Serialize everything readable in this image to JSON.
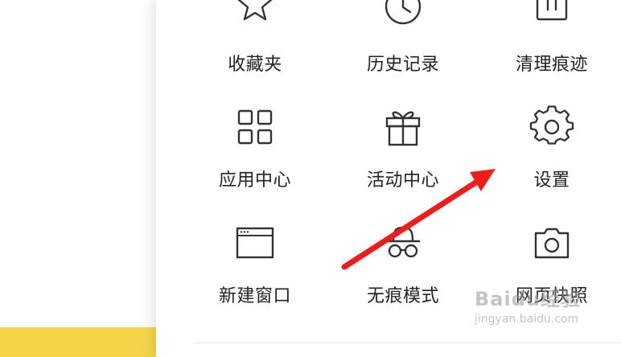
{
  "menu": {
    "items": [
      {
        "label": "收藏夹",
        "icon": "star-icon"
      },
      {
        "label": "历史记录",
        "icon": "clock-icon"
      },
      {
        "label": "清理痕迹",
        "icon": "trash-icon"
      },
      {
        "label": "应用中心",
        "icon": "grid-icon"
      },
      {
        "label": "活动中心",
        "icon": "gift-icon"
      },
      {
        "label": "设置",
        "icon": "gear-icon"
      },
      {
        "label": "新建窗口",
        "icon": "window-icon"
      },
      {
        "label": "无痕模式",
        "icon": "incognito-icon"
      },
      {
        "label": "网页快照",
        "icon": "camera-icon"
      }
    ]
  },
  "watermark": {
    "brand": "Baidu经验",
    "url": "jingyan.baidu.com"
  },
  "colors": {
    "arrow": "#ee1c1c",
    "yellow": "#f5d54a",
    "icon_stroke": "#333333",
    "label": "#222222"
  }
}
